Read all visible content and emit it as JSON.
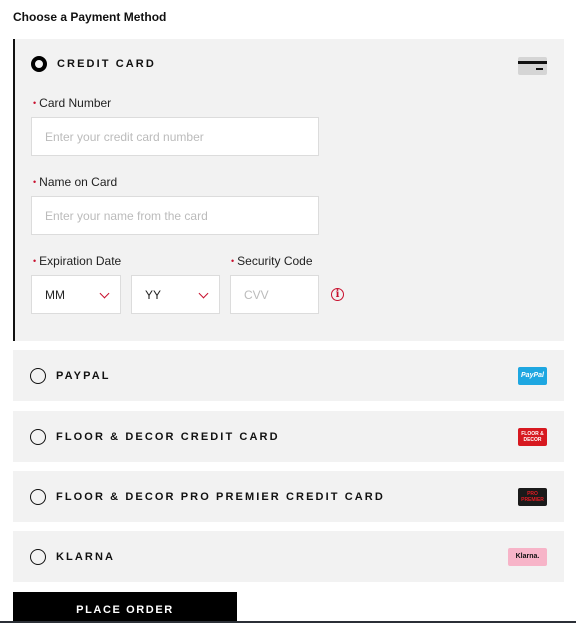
{
  "heading": "Choose a Payment Method",
  "credit_card": {
    "label": "CREDIT CARD",
    "selected": true,
    "icon": "credit-card-icon",
    "fields": {
      "card_number": {
        "label": "Card Number",
        "required_marker": "•",
        "placeholder": "Enter your credit card number",
        "value": ""
      },
      "name_on_card": {
        "label": "Name on Card",
        "required_marker": "•",
        "placeholder": "Enter your name from the card",
        "value": ""
      },
      "expiration": {
        "label": "Expiration Date",
        "required_marker": "•",
        "month": {
          "selected": "MM"
        },
        "year": {
          "selected": "YY"
        }
      },
      "security_code": {
        "label": "Security Code",
        "required_marker": "•",
        "placeholder": "CVV",
        "value": "",
        "info_icon": "ⓘ"
      }
    }
  },
  "options": [
    {
      "label": "PAYPAL",
      "selected": false,
      "logo_text": "PayPal",
      "logo_bg": "#1ea7e1",
      "logo_color": "#ffffff"
    },
    {
      "label": "FLOOR & DECOR CREDIT CARD",
      "selected": false,
      "logo_text": "FLOOR & DECOR",
      "logo_bg": "#d71920",
      "logo_color": "#ffffff"
    },
    {
      "label": "FLOOR & DECOR PRO PREMIER CREDIT CARD",
      "selected": false,
      "logo_text": "PRO PREMIER",
      "logo_bg": "#1a1a1a",
      "logo_color": "#e31b23"
    },
    {
      "label": "KLARNA",
      "selected": false,
      "logo_text": "Klarna.",
      "logo_bg": "#f7b4c8",
      "logo_color": "#111111"
    }
  ],
  "place_order_label": "PLACE ORDER",
  "colors": {
    "accent_red": "#c8102e",
    "panel_bg": "#f2f2f2",
    "button_bg": "#000000"
  }
}
